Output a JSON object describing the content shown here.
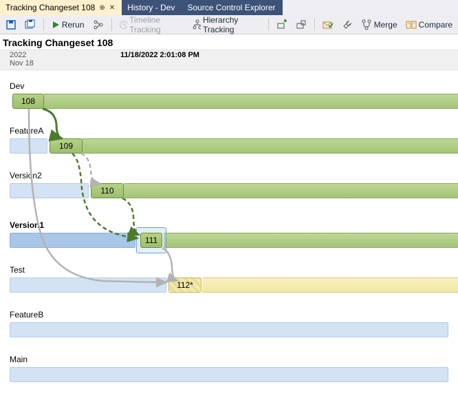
{
  "tabs": [
    {
      "label": "Tracking Changeset 108",
      "active": true,
      "pinned": true,
      "closable": true
    },
    {
      "label": "History - Dev",
      "active": false
    },
    {
      "label": "Source Control Explorer",
      "active": false
    }
  ],
  "toolbar": {
    "rerun": "Rerun",
    "timeline": "Timeline Tracking",
    "hierarchy": "Hierarchy Tracking",
    "merge": "Merge",
    "compare": "Compare"
  },
  "title": "Tracking Changeset 108",
  "time": {
    "year": "2022",
    "month_day": "Nov 18",
    "datetime": "11/18/2022 2:01:08 PM"
  },
  "branches": {
    "dev": "Dev",
    "featureA": "FeatureA",
    "version2": "Version2",
    "version1": "Version1",
    "test": "Test",
    "featureB": "FeatureB",
    "main": "Main"
  },
  "changesets": {
    "c108": "108",
    "c109": "109",
    "c110": "110",
    "c111": "111",
    "c112": "112*"
  }
}
